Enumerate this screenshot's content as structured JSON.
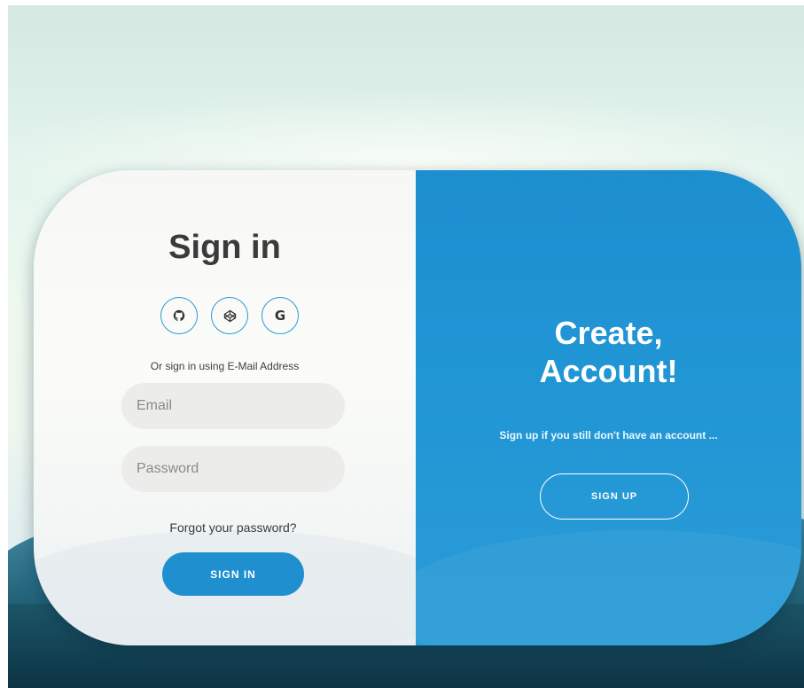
{
  "signin": {
    "title": "Sign in",
    "social": [
      {
        "icon": "github-icon"
      },
      {
        "icon": "codepen-icon"
      },
      {
        "icon": "google-icon",
        "glyph": "G"
      }
    ],
    "alt_text": "Or sign in using E-Mail Address",
    "email_placeholder": "Email",
    "password_placeholder": "Password",
    "forgot": "Forgot your password?",
    "button": "SIGN IN"
  },
  "signup": {
    "title_line1": "Create,",
    "title_line2": "Account!",
    "subtitle": "Sign up if you still don't have an account ...",
    "button": "SIGN UP"
  },
  "colors": {
    "accent": "#1f8fcf",
    "right_panel": "#2196d5",
    "left_panel": "#f7f8f5",
    "input_bg": "#ececea"
  }
}
